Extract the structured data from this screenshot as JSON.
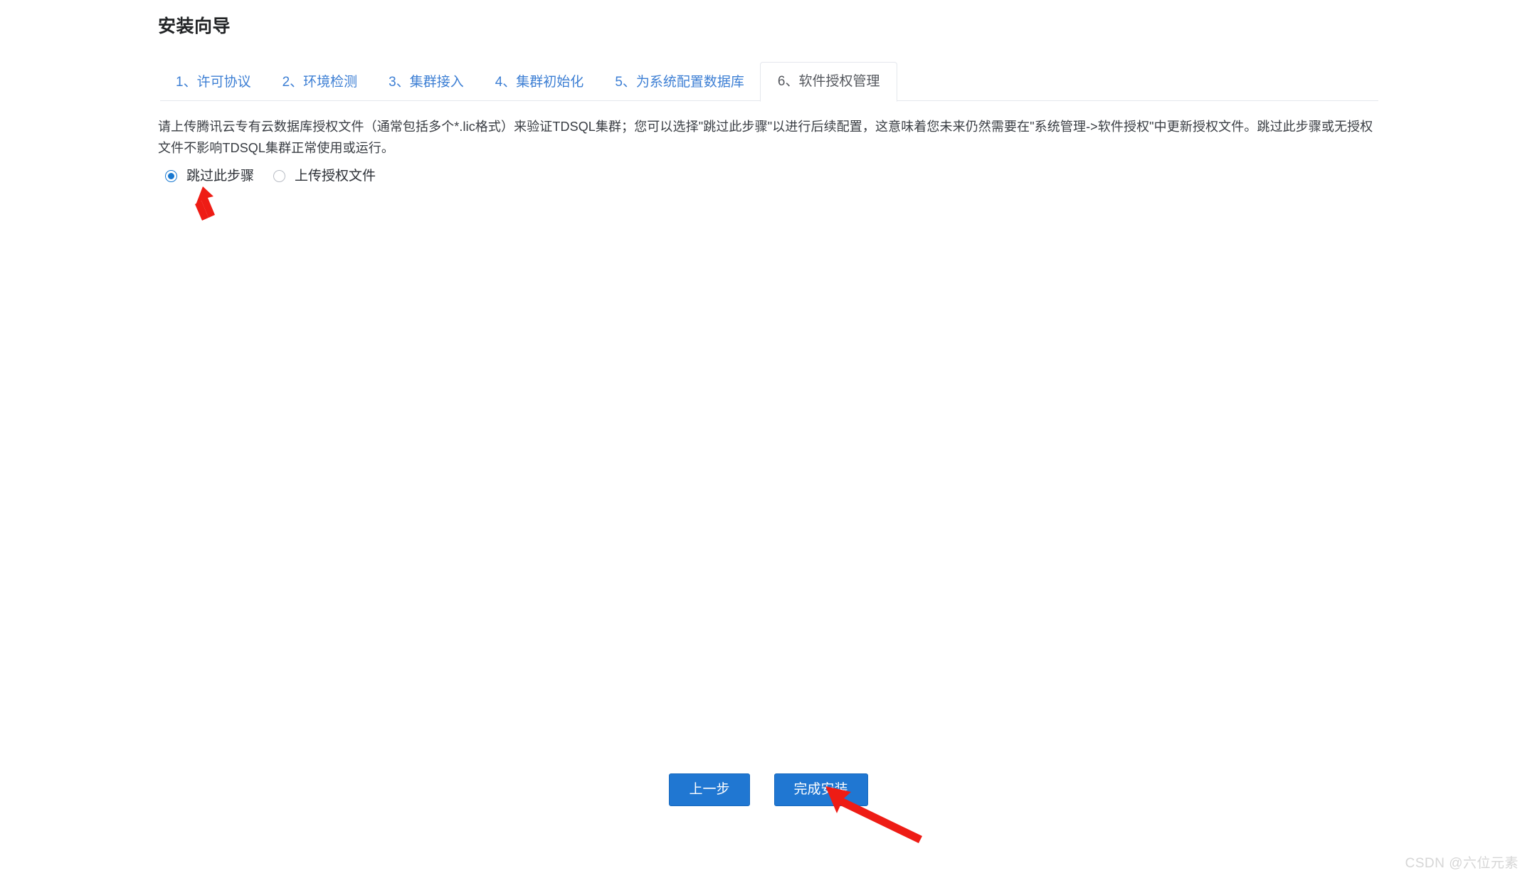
{
  "page": {
    "title": "安装向导"
  },
  "tabs": {
    "items": [
      {
        "label": "1、许可协议",
        "active": false
      },
      {
        "label": "2、环境检测",
        "active": false
      },
      {
        "label": "3、集群接入",
        "active": false
      },
      {
        "label": "4、集群初始化",
        "active": false
      },
      {
        "label": "5、为系统配置数据库",
        "active": false
      },
      {
        "label": "6、软件授权管理",
        "active": true
      }
    ]
  },
  "description": {
    "text": "请上传腾讯云专有云数据库授权文件（通常包括多个*.lic格式）来验证TDSQL集群；您可以选择\"跳过此步骤\"以进行后续配置，这意味着您未来仍然需要在\"系统管理->软件授权\"中更新授权文件。跳过此步骤或无授权文件不影响TDSQL集群正常使用或运行。"
  },
  "options": {
    "skip": {
      "label": "跳过此步骤",
      "selected": true
    },
    "upload": {
      "label": "上传授权文件",
      "selected": false
    }
  },
  "footer": {
    "prev_label": "上一步",
    "finish_label": "完成安装"
  },
  "annotations": {
    "arrow_color": "#ee1c15",
    "arrow_to_radio": "跳过此步骤",
    "arrow_to_button": "完成安装"
  },
  "watermark": {
    "text": "CSDN @六位元素"
  },
  "colors": {
    "tab_link": "#3d7fd4",
    "tab_active_text": "#55585e",
    "button_blue": "#2077d2",
    "radio_blue": "#1878d1",
    "divider": "#e4e7ed"
  }
}
